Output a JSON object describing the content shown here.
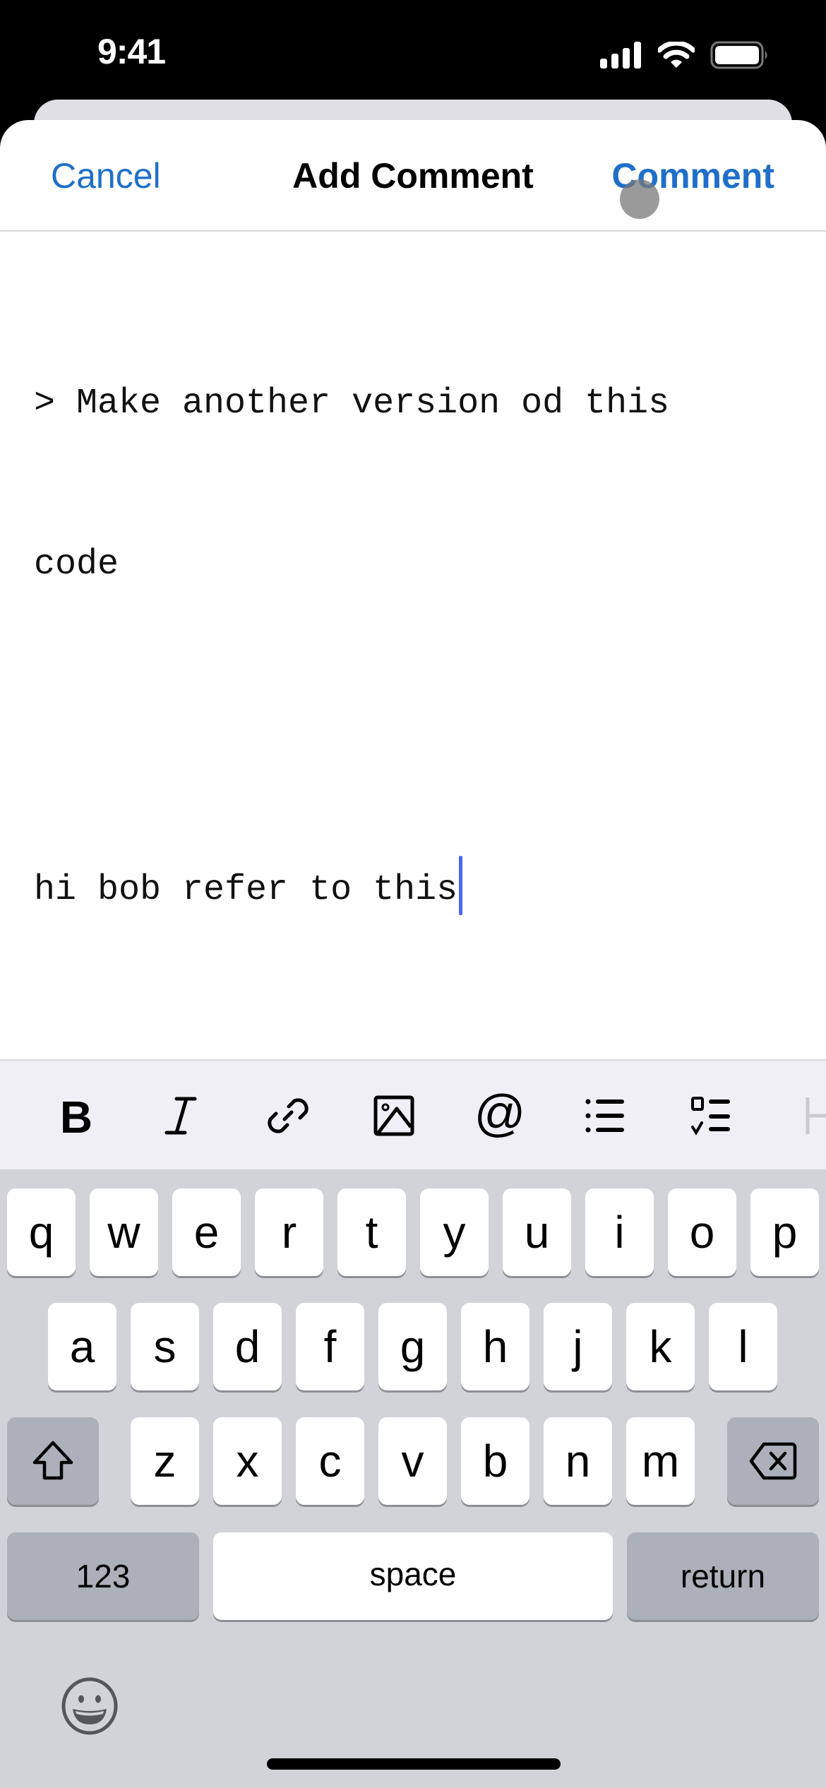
{
  "status_bar": {
    "time": "9:41",
    "icons": [
      "cellular-signal-icon",
      "wifi-icon",
      "battery-icon"
    ]
  },
  "nav": {
    "cancel_label": "Cancel",
    "title": "Add Comment",
    "submit_label": "Comment",
    "accent_color": "#1f6fc9"
  },
  "editor": {
    "lines": [
      "> Make another version od this",
      "code",
      "",
      "hi bob refer to this"
    ],
    "caret_color": "#4f68e6"
  },
  "format_toolbar": {
    "buttons": [
      {
        "name": "bold",
        "icon": "bold-icon"
      },
      {
        "name": "italic",
        "icon": "italic-icon"
      },
      {
        "name": "link",
        "icon": "link-icon"
      },
      {
        "name": "image",
        "icon": "image-icon"
      },
      {
        "name": "mention",
        "icon": "at-sign-icon"
      },
      {
        "name": "bulleted-list",
        "icon": "bullet-list-icon"
      },
      {
        "name": "task-list",
        "icon": "checklist-icon"
      },
      {
        "name": "heading",
        "icon": "heading-icon"
      }
    ]
  },
  "keyboard": {
    "row1": [
      "q",
      "w",
      "e",
      "r",
      "t",
      "y",
      "u",
      "i",
      "o",
      "p"
    ],
    "row2": [
      "a",
      "s",
      "d",
      "f",
      "g",
      "h",
      "j",
      "k",
      "l"
    ],
    "row3": [
      "z",
      "x",
      "c",
      "v",
      "b",
      "n",
      "m"
    ],
    "numbers_label": "123",
    "space_label": "space",
    "return_label": "return"
  }
}
